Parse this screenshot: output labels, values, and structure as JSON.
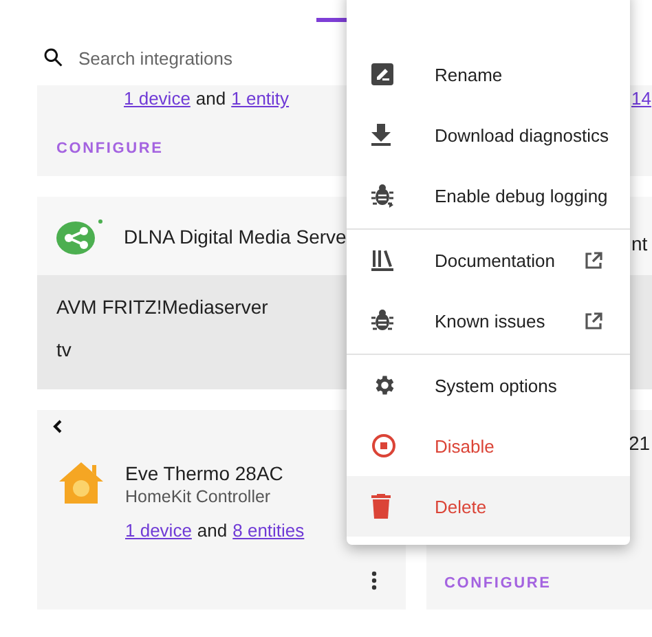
{
  "search": {
    "placeholder": "Search integrations"
  },
  "left_cards": [
    {
      "device_link": "1 device",
      "joiner": "and",
      "entity_link": "1 entity",
      "action": "CONFIGURE"
    },
    {
      "title": "DLNA Digital Media Serve",
      "entries": [
        "AVM FRITZ!Mediaserver",
        "tv"
      ]
    },
    {
      "title": "Eve Thermo 28AC",
      "subtitle": "HomeKit Controller",
      "device_link": "1 device",
      "joiner": "and",
      "entity_link": "8 entities"
    }
  ],
  "right_cards": [
    {
      "link": "14"
    },
    {
      "text": "nt"
    },
    {
      "text": "21",
      "action": "CONFIGURE"
    }
  ],
  "menu": {
    "items": [
      {
        "label": "Rename",
        "danger": false,
        "external": false,
        "divider_before": false,
        "selected": false
      },
      {
        "label": "Download diagnostics",
        "danger": false,
        "external": false,
        "divider_before": false,
        "selected": false
      },
      {
        "label": "Enable debug logging",
        "danger": false,
        "external": false,
        "divider_before": false,
        "selected": false
      },
      {
        "label": "Documentation",
        "danger": false,
        "external": true,
        "divider_before": true,
        "selected": false
      },
      {
        "label": "Known issues",
        "danger": false,
        "external": true,
        "divider_before": false,
        "selected": false
      },
      {
        "label": "System options",
        "danger": false,
        "external": false,
        "divider_before": true,
        "selected": false
      },
      {
        "label": "Disable",
        "danger": true,
        "external": false,
        "divider_before": false,
        "selected": false
      },
      {
        "label": "Delete",
        "danger": true,
        "external": false,
        "divider_before": false,
        "selected": true
      }
    ]
  }
}
